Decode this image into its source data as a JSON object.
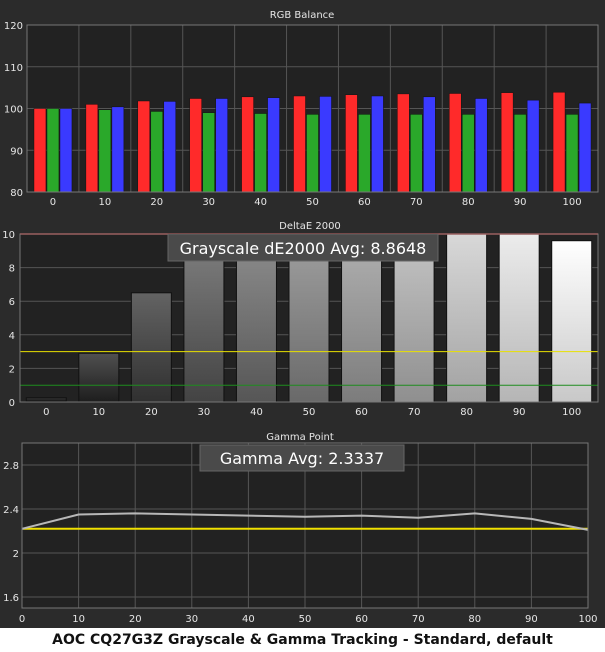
{
  "caption": "AOC CQ27G3Z Grayscale & Gamma Tracking - Standard, default",
  "colors": {
    "background": "#2b2b2b",
    "plot_background": "#222222",
    "red": "#ff2a2a",
    "green": "#2aa82a",
    "blue": "#3a3aff",
    "reference_red": "#e03030",
    "threshold_yellow": "#e8e000",
    "threshold_green": "#1e8c1e",
    "gamma_line": "#b8b8b8",
    "gamma_target": "#f0e000"
  },
  "chart_data": [
    {
      "type": "bar",
      "title": "RGB Balance",
      "categories": [
        "0",
        "10",
        "20",
        "30",
        "40",
        "50",
        "60",
        "70",
        "80",
        "90",
        "100"
      ],
      "series": [
        {
          "color": "red",
          "values": [
            100,
            101,
            101.8,
            102.4,
            102.8,
            103,
            103.3,
            103.5,
            103.6,
            103.8,
            103.9
          ]
        },
        {
          "color": "green",
          "values": [
            100,
            99.7,
            99.3,
            99,
            98.8,
            98.6,
            98.6,
            98.6,
            98.6,
            98.6,
            98.6
          ]
        },
        {
          "color": "blue",
          "values": [
            100,
            100.4,
            101.7,
            102.4,
            102.6,
            102.9,
            103,
            102.8,
            102.4,
            102,
            101.3
          ]
        }
      ],
      "ylim": [
        80,
        120
      ],
      "yticks": [
        "80",
        "90",
        "100",
        "110",
        "120"
      ],
      "grid": true
    },
    {
      "type": "bar",
      "title": "DeltaE 2000",
      "categories": [
        "0",
        "10",
        "20",
        "30",
        "40",
        "50",
        "60",
        "70",
        "80",
        "90",
        "100"
      ],
      "values": [
        0.25,
        2.9,
        6.5,
        8.4,
        9.2,
        9.6,
        9.9,
        10.3,
        10.4,
        10.4,
        9.6
      ],
      "annotation": "Grayscale dE2000 Avg: 8.8648",
      "ylim": [
        0,
        10
      ],
      "yticks": [
        "0",
        "2",
        "4",
        "6",
        "8",
        "10"
      ],
      "reference_lines": [
        1,
        3,
        10
      ],
      "grid": true
    },
    {
      "type": "line",
      "title": "Gamma Point",
      "x": [
        0,
        10,
        20,
        30,
        40,
        50,
        60,
        70,
        80,
        90,
        100
      ],
      "values": [
        2.22,
        2.35,
        2.36,
        2.35,
        2.34,
        2.33,
        2.34,
        2.32,
        2.36,
        2.31,
        2.21
      ],
      "target": 2.22,
      "annotation": "Gamma Avg: 2.3337",
      "ylim": [
        1.5,
        3.0
      ],
      "yticks": [
        "1.6",
        "2",
        "2.4",
        "2.8"
      ],
      "xticks": [
        "0",
        "10",
        "20",
        "30",
        "40",
        "50",
        "60",
        "70",
        "80",
        "90",
        "100"
      ],
      "grid": true
    }
  ]
}
